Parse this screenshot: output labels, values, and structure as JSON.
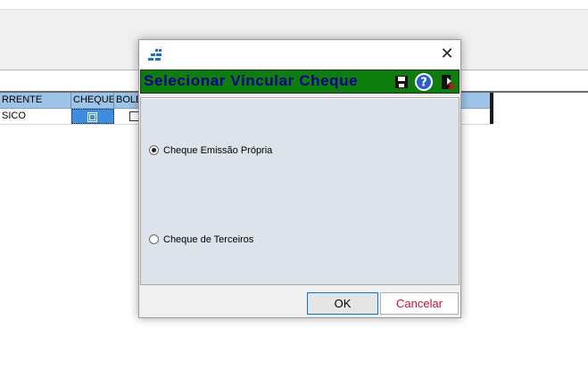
{
  "grid": {
    "columns": [
      "RRENTE",
      "CHEQUE",
      "BOLE"
    ],
    "row": {
      "first_cell": "SICO"
    }
  },
  "dialog": {
    "title_icon": "app-logo-icon",
    "close_label": "✕",
    "header_title": "Selecionar Vincular Cheque",
    "header_icons": [
      "save-icon",
      "help-icon",
      "exit-icon"
    ],
    "options": [
      {
        "label": "Cheque Emissão Própria",
        "checked": true
      },
      {
        "label": "Cheque de Terceiros",
        "checked": false
      }
    ],
    "ok_label": "OK",
    "cancel_label": "Cancelar"
  },
  "colors": {
    "header_bg": "#0d7d0d",
    "header_text": "#00008b",
    "grid_header": "#9dc3e6",
    "selected_cell": "#3d8ee0",
    "cancel_text": "#c8102e"
  }
}
